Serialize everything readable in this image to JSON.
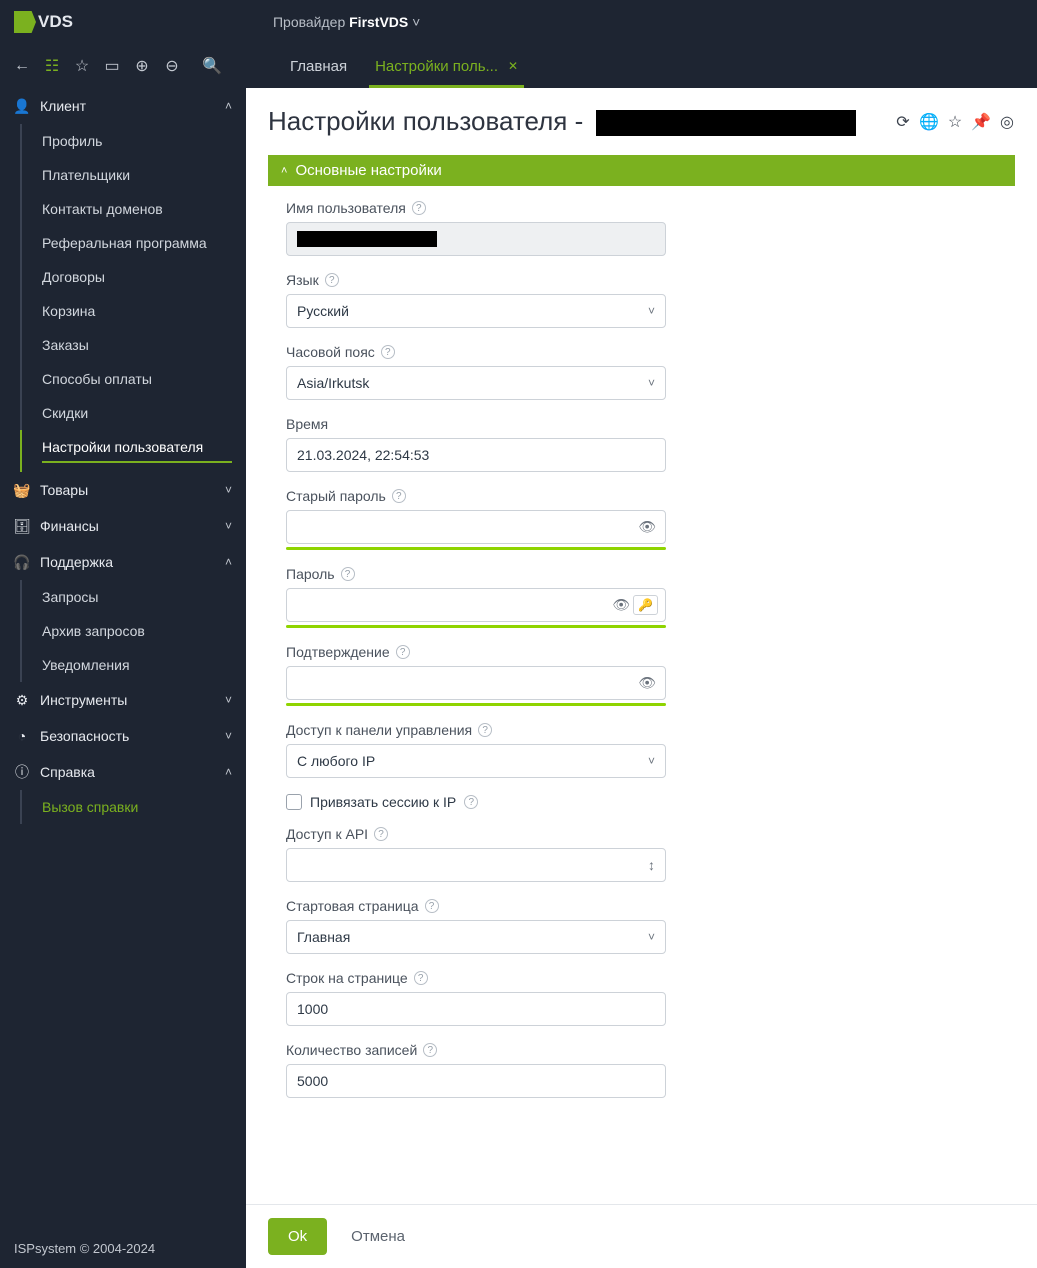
{
  "header": {
    "provider_label": "Провайдер",
    "provider_name": "FirstVDS"
  },
  "tabs": {
    "main": "Главная",
    "active": "Настройки поль..."
  },
  "sidebar": {
    "groups": [
      {
        "label": "Клиент",
        "items": [
          "Профиль",
          "Плательщики",
          "Контакты доменов",
          "Реферальная программа",
          "Договоры",
          "Корзина",
          "Заказы",
          "Способы оплаты",
          "Скидки",
          "Настройки пользователя"
        ],
        "open": true,
        "active_index": 9
      },
      {
        "label": "Товары",
        "open": false
      },
      {
        "label": "Финансы",
        "open": false
      },
      {
        "label": "Поддержка",
        "items": [
          "Запросы",
          "Архив запросов",
          "Уведомления"
        ],
        "open": true
      },
      {
        "label": "Инструменты",
        "open": false
      },
      {
        "label": "Безопасность",
        "open": false
      },
      {
        "label": "Справка",
        "items_special": [
          "Вызов справки"
        ],
        "open": true
      }
    ],
    "footer": "ISPsystem © 2004-2024"
  },
  "page": {
    "title": "Настройки пользователя -",
    "section": "Основные настройки"
  },
  "form": {
    "username_label": "Имя пользователя",
    "language_label": "Язык",
    "language_value": "Русский",
    "timezone_label": "Часовой пояс",
    "timezone_value": "Asia/Irkutsk",
    "time_label": "Время",
    "time_value": "21.03.2024, 22:54:53",
    "old_password_label": "Старый пароль",
    "password_label": "Пароль",
    "confirm_label": "Подтверждение",
    "panel_access_label": "Доступ к панели управления",
    "panel_access_value": "С любого IP",
    "bind_ip_label": "Привязать сессию к IP",
    "api_access_label": "Доступ к API",
    "start_page_label": "Стартовая страница",
    "start_page_value": "Главная",
    "rows_label": "Строк на странице",
    "rows_value": "1000",
    "records_label": "Количество записей",
    "records_value": "5000"
  },
  "buttons": {
    "ok": "Ok",
    "cancel": "Отмена"
  }
}
